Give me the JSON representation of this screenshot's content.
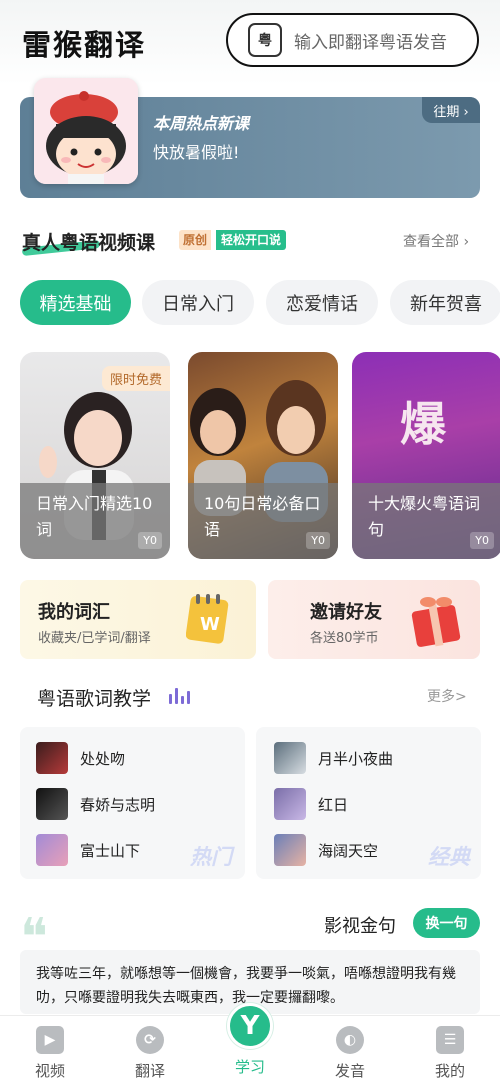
{
  "app": {
    "logo": "雷猴翻译"
  },
  "search": {
    "icon_label": "粤",
    "placeholder": "输入即翻译粤语发音"
  },
  "banner": {
    "title": "本周热点新课",
    "subtitle": "快放暑假啦!",
    "past_label": "往期 ›"
  },
  "video_section": {
    "title": "真人粤语视频课",
    "tag_original": "原创",
    "tag_easy": "轻松开口说",
    "see_all": "查看全部 ›",
    "tabs": [
      "精选基础",
      "日常入门",
      "恋爱情话",
      "新年贺喜"
    ],
    "cards": [
      {
        "title": "日常入门精选10词",
        "price": "Y0",
        "badge": "限时免费"
      },
      {
        "title": "10句日常必备口语",
        "price": "Y0"
      },
      {
        "title": "十大爆火粤语词句",
        "price": "Y0",
        "art_text": "爆"
      }
    ]
  },
  "promos": [
    {
      "title": "我的词汇",
      "subtitle": "收藏夹/已学词/翻译"
    },
    {
      "title": "邀请好友",
      "subtitle": "各送80学币"
    }
  ],
  "lyrics": {
    "title": "粤语歌词教学",
    "more": "更多>",
    "left": {
      "songs": [
        "处处吻",
        "春娇与志明",
        "富士山下"
      ],
      "watermark": "热门"
    },
    "right": {
      "songs": [
        "月半小夜曲",
        "红日",
        "海阔天空"
      ],
      "watermark": "经典"
    }
  },
  "quote": {
    "title": "影视金句",
    "refresh": "换一句",
    "text": "我等咗三年，就喺想等一個機會，我要爭一啖氣，唔喺想證明我有幾叻，只喺要證明我失去嘅東西，我一定要攞翻嚟。"
  },
  "nav": {
    "items": [
      "视频",
      "翻译",
      "学习",
      "发音",
      "我的"
    ],
    "center_icon": "Y"
  },
  "colors": {
    "accent": "#26bc8b",
    "banner": "#6d8ca3"
  }
}
